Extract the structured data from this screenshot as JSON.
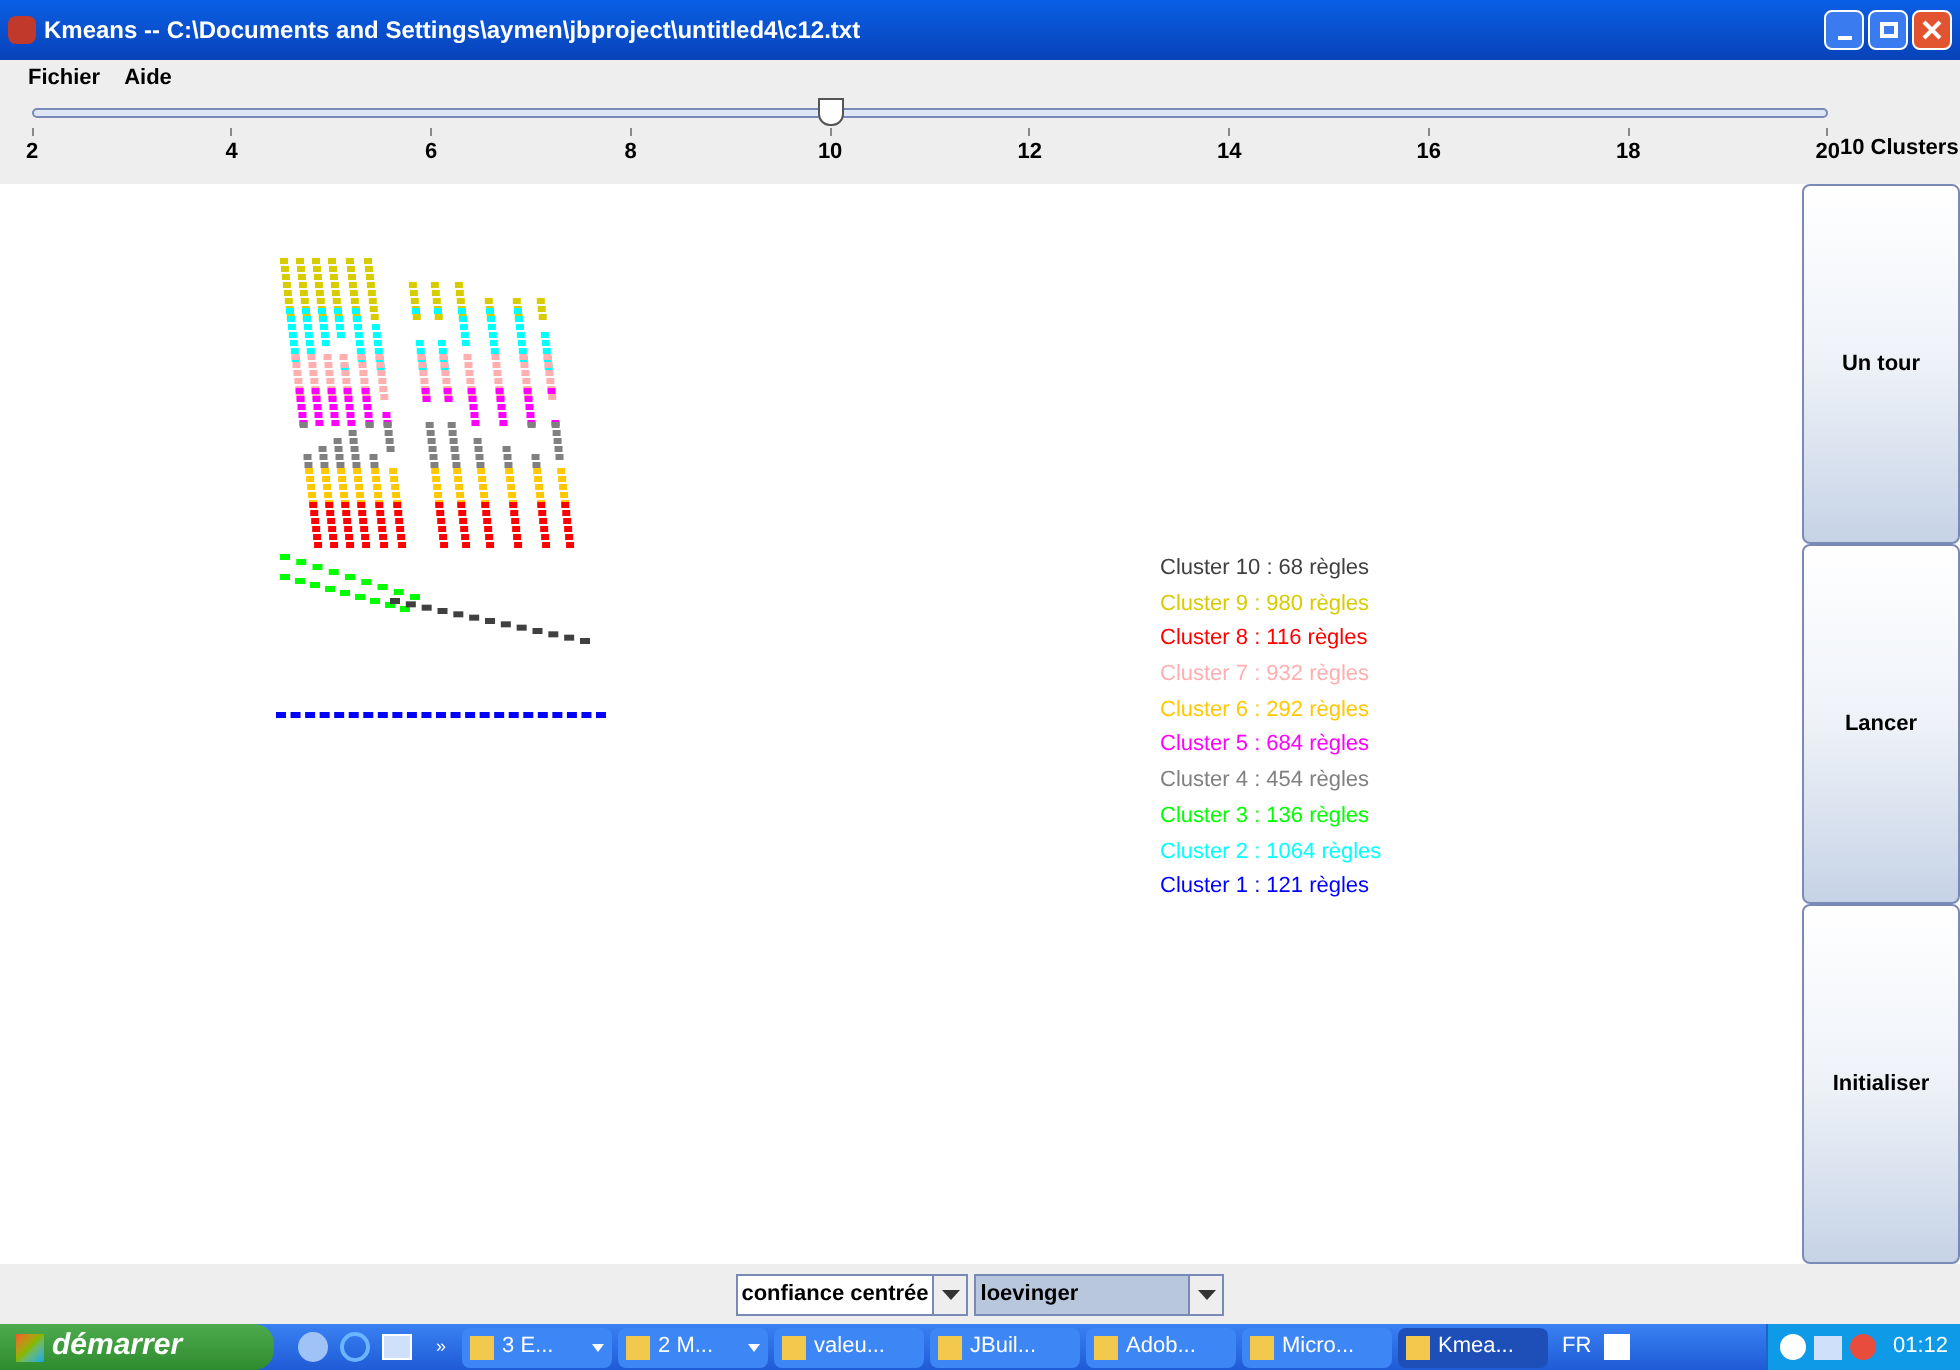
{
  "window": {
    "title": "Kmeans -- C:\\Documents and Settings\\aymen\\jbproject\\untitled4\\c12.txt"
  },
  "menu": [
    "Fichier",
    "Aide"
  ],
  "slider": {
    "level": 0.4444,
    "ticks": [
      "2",
      "4",
      "6",
      "8",
      "10",
      "12",
      "14",
      "16",
      "18",
      "20"
    ],
    "reading": "10 Clusters"
  },
  "legend": [
    {
      "label": "Cluster 10 : 68 règles",
      "color": "#404040"
    },
    {
      "label": "Cluster 9 : 980 règles",
      "color": "#d8cc00"
    },
    {
      "label": "Cluster 8 : 116 règles",
      "color": "#ff0000"
    },
    {
      "label": "Cluster 7 : 932 règles",
      "color": "#ffafaf"
    },
    {
      "label": "Cluster 6 : 292 règles",
      "color": "#ffc800"
    },
    {
      "label": "Cluster 5 : 684 règles",
      "color": "#ff00ff"
    },
    {
      "label": "Cluster 4 : 454 règles",
      "color": "#808080"
    },
    {
      "label": "Cluster 3 : 136 règles",
      "color": "#00ff00"
    },
    {
      "label": "Cluster 2 : 1064 règles",
      "color": "#00ffff"
    },
    {
      "label": "Cluster 1 : 121 règles",
      "color": "#0000ff"
    }
  ],
  "buttons": [
    "Un tour",
    "Lancer",
    "Initialiser"
  ],
  "combos": [
    {
      "value": "confiance centrée",
      "selected": false
    },
    {
      "value": "loevinger",
      "selected": true
    }
  ],
  "taskbar": {
    "start": "démarrer",
    "more": "»",
    "tasks": [
      {
        "label": "3 E...",
        "selected": false,
        "menu": true
      },
      {
        "label": "2 M...",
        "selected": false,
        "menu": true
      },
      {
        "label": "valeu...",
        "selected": false,
        "menu": false
      },
      {
        "label": "JBuil...",
        "selected": false,
        "menu": false
      },
      {
        "label": "Adob...",
        "selected": false,
        "menu": false
      },
      {
        "label": "Micro...",
        "selected": false,
        "menu": false
      },
      {
        "label": "Kmea...",
        "selected": true,
        "menu": false
      }
    ],
    "language": "FR",
    "time": "01:12"
  }
}
